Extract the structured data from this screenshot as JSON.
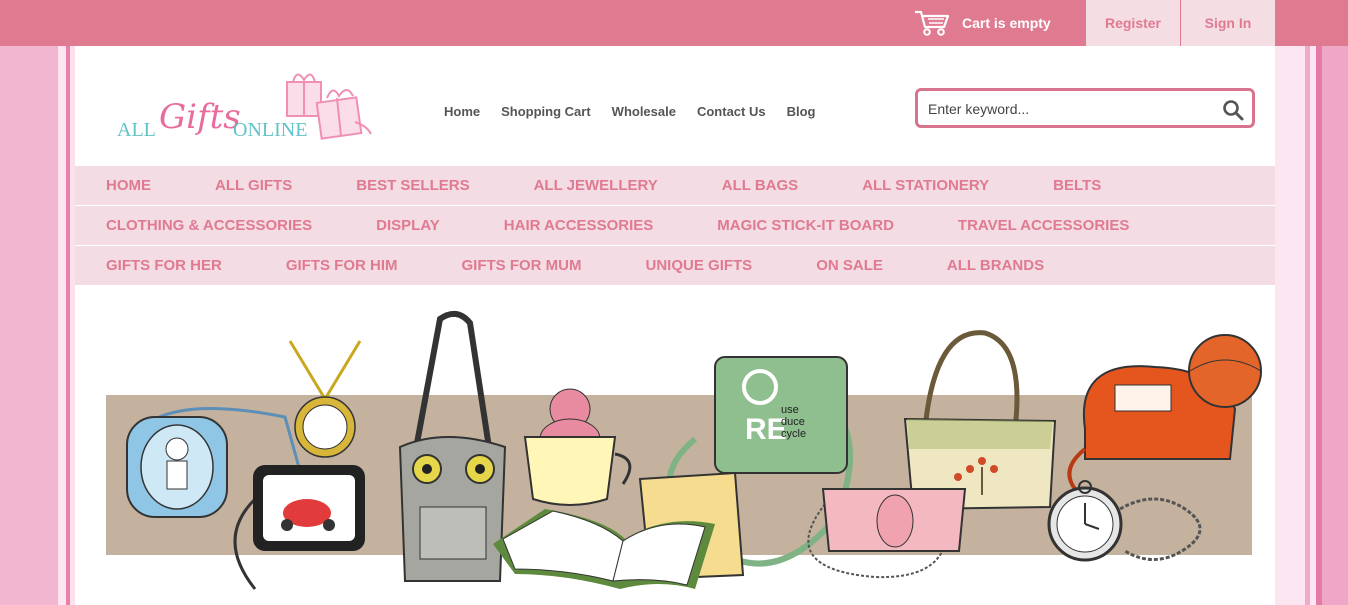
{
  "topbar": {
    "cart_text": "Cart is empty",
    "register_label": "Register",
    "signin_label": "Sign In"
  },
  "logo": {
    "all": "ALL",
    "gifts": "Gifts",
    "online": "ONLINE"
  },
  "header_links": [
    "Home",
    "Shopping Cart",
    "Wholesale",
    "Contact Us",
    "Blog"
  ],
  "search": {
    "placeholder": "Enter keyword..."
  },
  "categories": {
    "row1": [
      "HOME",
      "ALL GIFTS",
      "BEST SELLERS",
      "ALL JEWELLERY",
      "ALL BAGS",
      "ALL STATIONERY",
      "BELTS"
    ],
    "row2": [
      "CLOTHING & ACCESSORIES",
      "DISPLAY",
      "HAIR ACCESSORIES",
      "MAGIC STICK-IT BOARD",
      "TRAVEL ACCESSORIES"
    ],
    "row3": [
      "GIFTS FOR HER",
      "GIFTS FOR HIM",
      "GIFTS FOR MUM",
      "UNIQUE GIFTS",
      "ON SALE",
      "ALL BRANDS"
    ]
  },
  "banner": {
    "recycle_line1": "use",
    "recycle_line2": "duce",
    "recycle_line3": "cycle",
    "recycle_big": "RE"
  },
  "colors": {
    "topbar": "#e07a91",
    "accent_pink": "#e07a91",
    "nav_bg": "#f3dce3",
    "search_border": "#d9748e"
  }
}
